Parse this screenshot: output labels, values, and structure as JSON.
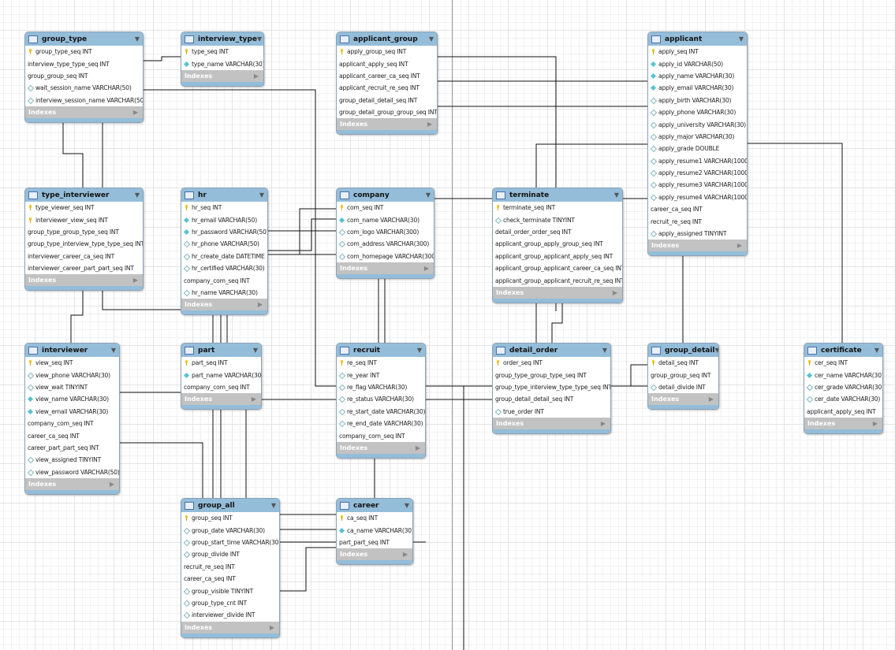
{
  "diagram": {
    "index_label": "Indexes",
    "colors": {
      "header": "#94bdd9",
      "indexes_bar": "#c2c2c2",
      "primary_key": "#f2c21b",
      "not_null": "#56c3d0"
    },
    "tables": [
      {
        "name": "group_type",
        "columns": [
          {
            "text": "group_type_seq INT",
            "icon": "key"
          },
          {
            "text": "interview_type_type_seq INT",
            "icon": "none"
          },
          {
            "text": "group_group_seq INT",
            "icon": "none"
          },
          {
            "text": "wait_session_name VARCHAR(50)",
            "icon": "diamond-open"
          },
          {
            "text": "interview_session_name VARCHAR(50)",
            "icon": "diamond-open"
          }
        ]
      },
      {
        "name": "interview_type",
        "columns": [
          {
            "text": "type_seq INT",
            "icon": "key"
          },
          {
            "text": "type_name VARCHAR(30)",
            "icon": "diamond-filled"
          }
        ]
      },
      {
        "name": "applicant_group",
        "columns": [
          {
            "text": "apply_group_seq INT",
            "icon": "key"
          },
          {
            "text": "applicant_apply_seq INT",
            "icon": "none"
          },
          {
            "text": "applicant_career_ca_seq INT",
            "icon": "none"
          },
          {
            "text": "applicant_recruit_re_seq INT",
            "icon": "none"
          },
          {
            "text": "group_detail_detail_seq INT",
            "icon": "none"
          },
          {
            "text": "group_detail_group_group_seq INT",
            "icon": "none"
          }
        ]
      },
      {
        "name": "applicant",
        "columns": [
          {
            "text": "apply_seq INT",
            "icon": "key"
          },
          {
            "text": "apply_id VARCHAR(50)",
            "icon": "diamond-filled"
          },
          {
            "text": "apply_name VARCHAR(30)",
            "icon": "diamond-filled"
          },
          {
            "text": "apply_email VARCHAR(30)",
            "icon": "diamond-filled"
          },
          {
            "text": "apply_birth VARCHAR(30)",
            "icon": "diamond-open"
          },
          {
            "text": "apply_phone VARCHAR(30)",
            "icon": "diamond-open"
          },
          {
            "text": "apply_university VARCHAR(30)",
            "icon": "diamond-open"
          },
          {
            "text": "apply_major VARCHAR(30)",
            "icon": "diamond-open"
          },
          {
            "text": "apply_grade DOUBLE",
            "icon": "diamond-open"
          },
          {
            "text": "apply_resume1 VARCHAR(1000)",
            "icon": "diamond-open"
          },
          {
            "text": "apply_resume2 VARCHAR(1000)",
            "icon": "diamond-open"
          },
          {
            "text": "apply_resume3 VARCHAR(1000)",
            "icon": "diamond-open"
          },
          {
            "text": "apply_resume4 VARCHAR(1000)",
            "icon": "diamond-open"
          },
          {
            "text": "career_ca_seq INT",
            "icon": "none"
          },
          {
            "text": "recruit_re_seq INT",
            "icon": "none"
          },
          {
            "text": "apply_assigned TINYINT",
            "icon": "diamond-open"
          }
        ]
      },
      {
        "name": "type_interviewer",
        "columns": [
          {
            "text": "type_viewer_seq INT",
            "icon": "key"
          },
          {
            "text": "interviewer_view_seq INT",
            "icon": "key"
          },
          {
            "text": "group_type_group_type_seq INT",
            "icon": "none"
          },
          {
            "text": "group_type_interview_type_type_seq INT",
            "icon": "none"
          },
          {
            "text": "interviewer_career_ca_seq INT",
            "icon": "none"
          },
          {
            "text": "interviewer_career_part_part_seq INT",
            "icon": "none"
          }
        ]
      },
      {
        "name": "hr",
        "columns": [
          {
            "text": "hr_seq INT",
            "icon": "key"
          },
          {
            "text": "hr_email VARCHAR(50)",
            "icon": "diamond-filled"
          },
          {
            "text": "hr_password VARCHAR(50)",
            "icon": "diamond-filled"
          },
          {
            "text": "hr_phone VARCHAR(50)",
            "icon": "diamond-open"
          },
          {
            "text": "hr_create_date DATETIME",
            "icon": "diamond-open"
          },
          {
            "text": "hr_certified VARCHAR(30)",
            "icon": "diamond-open"
          },
          {
            "text": "company_com_seq INT",
            "icon": "none"
          },
          {
            "text": "hr_name VARCHAR(30)",
            "icon": "diamond-open"
          }
        ]
      },
      {
        "name": "company",
        "columns": [
          {
            "text": "com_seq INT",
            "icon": "key"
          },
          {
            "text": "com_name VARCHAR(30)",
            "icon": "diamond-filled"
          },
          {
            "text": "com_logo VARCHAR(300)",
            "icon": "diamond-open"
          },
          {
            "text": "com_address VARCHAR(300)",
            "icon": "diamond-open"
          },
          {
            "text": "com_homepage VARCHAR(300)",
            "icon": "diamond-open"
          }
        ]
      },
      {
        "name": "terminate",
        "columns": [
          {
            "text": "terminate_seq INT",
            "icon": "key"
          },
          {
            "text": "check_terminate TINYINT",
            "icon": "diamond-open"
          },
          {
            "text": "detail_order_order_seq INT",
            "icon": "none"
          },
          {
            "text": "applicant_group_apply_group_seq INT",
            "icon": "none"
          },
          {
            "text": "applicant_group_applicant_apply_seq INT",
            "icon": "none"
          },
          {
            "text": "applicant_group_applicant_career_ca_seq INT",
            "icon": "none"
          },
          {
            "text": "applicant_group_applicant_recruit_re_seq INT",
            "icon": "none"
          }
        ]
      },
      {
        "name": "interviewer",
        "columns": [
          {
            "text": "view_seq INT",
            "icon": "key"
          },
          {
            "text": "view_phone VARCHAR(30)",
            "icon": "diamond-open"
          },
          {
            "text": "view_wait TINYINT",
            "icon": "diamond-open"
          },
          {
            "text": "view_name VARCHAR(30)",
            "icon": "diamond-filled"
          },
          {
            "text": "view_email VARCHAR(30)",
            "icon": "diamond-filled"
          },
          {
            "text": "company_com_seq INT",
            "icon": "none"
          },
          {
            "text": "career_ca_seq INT",
            "icon": "none"
          },
          {
            "text": "career_part_part_seq INT",
            "icon": "none"
          },
          {
            "text": "view_assigned TINYINT",
            "icon": "diamond-open"
          },
          {
            "text": "view_password VARCHAR(50)",
            "icon": "diamond-open"
          }
        ]
      },
      {
        "name": "part",
        "columns": [
          {
            "text": "part_seq INT",
            "icon": "key"
          },
          {
            "text": "part_name VARCHAR(30)",
            "icon": "diamond-filled"
          },
          {
            "text": "company_com_seq INT",
            "icon": "none"
          }
        ]
      },
      {
        "name": "recruit",
        "columns": [
          {
            "text": "re_seq INT",
            "icon": "key"
          },
          {
            "text": "re_year INT",
            "icon": "diamond-open"
          },
          {
            "text": "re_flag VARCHAR(30)",
            "icon": "diamond-open"
          },
          {
            "text": "re_status VARCHAR(30)",
            "icon": "diamond-open"
          },
          {
            "text": "re_start_date VARCHAR(30)",
            "icon": "diamond-open"
          },
          {
            "text": "re_end_date VARCHAR(30)",
            "icon": "diamond-open"
          },
          {
            "text": "company_com_seq INT",
            "icon": "none"
          }
        ]
      },
      {
        "name": "detail_order",
        "columns": [
          {
            "text": "order_seq INT",
            "icon": "key"
          },
          {
            "text": "group_type_group_type_seq INT",
            "icon": "none"
          },
          {
            "text": "group_type_interview_type_type_seq INT",
            "icon": "none"
          },
          {
            "text": "group_detail_detail_seq INT",
            "icon": "none"
          },
          {
            "text": "true_order INT",
            "icon": "diamond-open"
          }
        ]
      },
      {
        "name": "group_detail",
        "columns": [
          {
            "text": "detail_seq INT",
            "icon": "key"
          },
          {
            "text": "group_group_seq INT",
            "icon": "none"
          },
          {
            "text": "detail_divide INT",
            "icon": "diamond-open"
          }
        ]
      },
      {
        "name": "certificate",
        "columns": [
          {
            "text": "cer_seq INT",
            "icon": "key"
          },
          {
            "text": "cer_name VARCHAR(30)",
            "icon": "diamond-filled"
          },
          {
            "text": "cer_grade VARCHAR(30)",
            "icon": "diamond-open"
          },
          {
            "text": "cer_date VARCHAR(30)",
            "icon": "diamond-open"
          },
          {
            "text": "applicant_apply_seq INT",
            "icon": "none"
          }
        ]
      },
      {
        "name": "group_all",
        "columns": [
          {
            "text": "group_seq INT",
            "icon": "key"
          },
          {
            "text": "group_date VARCHAR(30)",
            "icon": "diamond-open"
          },
          {
            "text": "group_start_time VARCHAR(30)",
            "icon": "diamond-open"
          },
          {
            "text": "group_divide INT",
            "icon": "diamond-open"
          },
          {
            "text": "recruit_re_seq INT",
            "icon": "none"
          },
          {
            "text": "career_ca_seq INT",
            "icon": "none"
          },
          {
            "text": "group_visible TINYINT",
            "icon": "diamond-open"
          },
          {
            "text": "group_type_cnt INT",
            "icon": "diamond-open"
          },
          {
            "text": "interviewer_divide INT",
            "icon": "diamond-open"
          }
        ]
      },
      {
        "name": "career",
        "columns": [
          {
            "text": "ca_seq INT",
            "icon": "key"
          },
          {
            "text": "ca_name VARCHAR(30)",
            "icon": "diamond-filled"
          },
          {
            "text": "part_part_seq INT",
            "icon": "none"
          }
        ]
      }
    ]
  }
}
